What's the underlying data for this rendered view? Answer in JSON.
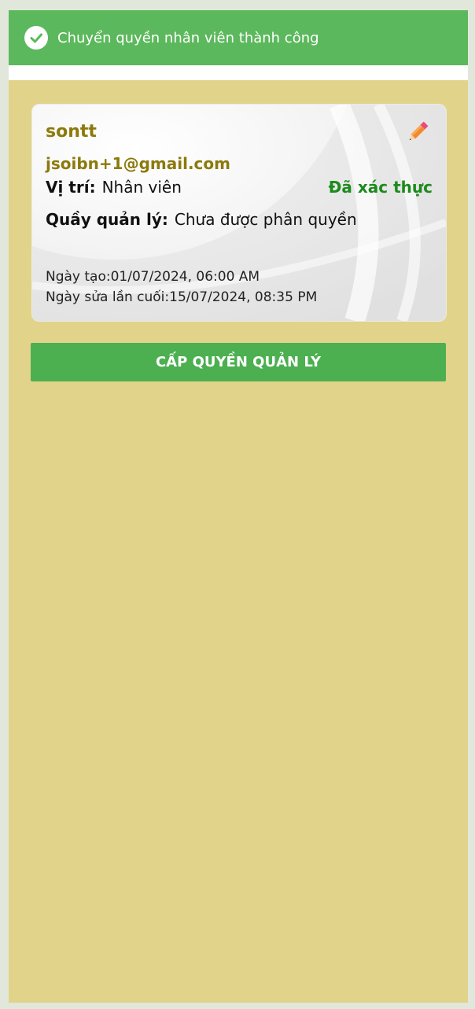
{
  "toast": {
    "message": "Chuyển quyền nhân viên thành công",
    "icon": "check-circle-icon"
  },
  "employee": {
    "username": "sontt",
    "email": "jsoibn+1@gmail.com",
    "position_label": "Vị trí:",
    "position_value": "Nhân viên",
    "verified_status": "Đã xác thực",
    "counter_label": "Quầy quản lý:",
    "counter_value": "Chưa được phân quyền",
    "created_at": "Ngày tạo:01/07/2024, 06:00 AM",
    "modified_at": "Ngày sửa lần cuối:15/07/2024, 08:35 PM",
    "edit_icon": "pencil-icon"
  },
  "actions": {
    "grant_label": "CẤP QUYỀN QUẢN LÝ"
  },
  "colors": {
    "toast_bg": "#5cb85c",
    "page_bg": "#e1d38a",
    "name_color": "#8b7a0c",
    "verified_color": "#1c8a1c",
    "button_bg": "#4caf50"
  }
}
